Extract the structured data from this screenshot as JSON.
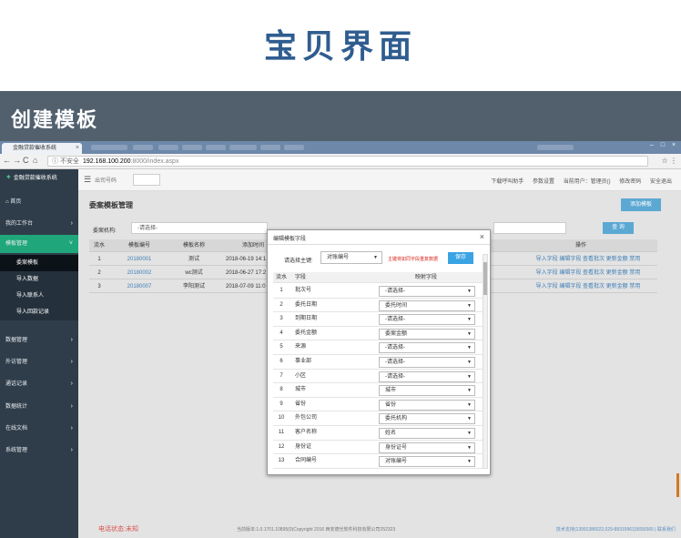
{
  "hero": {
    "title": "宝贝界面"
  },
  "banner": {
    "title": "创建模板"
  },
  "browser": {
    "tab_title": "金融贷款催收系统",
    "tab_close": "×",
    "nav": {
      "back": "←",
      "forward": "→",
      "reload": "C",
      "home": "⌂"
    },
    "url_unsafe": "ⓘ 不安全",
    "url_host": "192.168.100.200",
    "url_rest": ":8000/index.aspx",
    "star": "☆",
    "menu": "⋮",
    "win_min": "–",
    "win_max": "□",
    "win_close": "×"
  },
  "sidebar": {
    "logo": "金融贷款催收系统",
    "items": [
      {
        "label": "首页",
        "arrow": ""
      },
      {
        "label": "我的工作台",
        "arrow": "›"
      },
      {
        "label": "模板管理",
        "arrow": "˅"
      },
      {
        "label": "数据管理",
        "arrow": "›"
      },
      {
        "label": "外访管理",
        "arrow": "›"
      },
      {
        "label": "通话记录",
        "arrow": "›"
      },
      {
        "label": "数据统计",
        "arrow": "›"
      },
      {
        "label": "在线文档",
        "arrow": "›"
      },
      {
        "label": "系统管理",
        "arrow": "›"
      }
    ],
    "sub_items": [
      {
        "label": "委案模板"
      },
      {
        "label": "导入数据"
      },
      {
        "label": "导入联系人"
      },
      {
        "label": "导入回款记录"
      }
    ]
  },
  "topnav": {
    "menu_icon": "☰",
    "search_label": "出司号码",
    "links": [
      "下载呼叫助手",
      "参数设置",
      "当前用户：管理员()",
      "修改密码",
      "安全退出"
    ]
  },
  "content": {
    "panel_title": "委案模板管理",
    "add_button": "添加模板",
    "filter_label": "委案机构:",
    "filter_placeholder": "-请选择-",
    "query_button": "查 询",
    "table": {
      "headers": [
        "流水",
        "模板编号",
        "模板名称",
        "添加时间",
        "操作"
      ],
      "rows": [
        {
          "no": "1",
          "code": "20180001",
          "name": "测试",
          "time": "2018-06-19 14:1",
          "ops": "导入字段 编辑字段 查看批次 更新金额 禁用"
        },
        {
          "no": "2",
          "code": "20180002",
          "name": "wc测试",
          "time": "2018-06-27 17:2",
          "ops": "导入字段 编辑字段 查看批次 更新金额 禁用"
        },
        {
          "no": "3",
          "code": "20180007",
          "name": "李阳测试",
          "time": "2018-07-09 11:0",
          "ops": "导入字段 编辑字段 查看批次 更新金额 禁用"
        }
      ]
    },
    "footer_status": "电话状态:未知",
    "footer_copy": "当前版本:1.0.1701.10895(0)Copyright 2016 西安德光软件科技有限公司252323",
    "footer_right": "技术支持(13991386022,029-88319961)5656565 | 联系我们"
  },
  "modal": {
    "title": "编辑模板字段",
    "close": "×",
    "key_label": "请选择主键:",
    "key_value": "对账编号",
    "key_hint": "主键将如同字段重复数据",
    "save_button": "保存",
    "headers": [
      "流水",
      "字段",
      "映射字段"
    ],
    "rows": [
      {
        "no": "1",
        "field": "批次号",
        "map": "-请选择-"
      },
      {
        "no": "2",
        "field": "委托日期",
        "map": "委托时间"
      },
      {
        "no": "3",
        "field": "到期日期",
        "map": "-请选择-"
      },
      {
        "no": "4",
        "field": "委托金额",
        "map": "委案金额"
      },
      {
        "no": "5",
        "field": "来源",
        "map": "-请选择-"
      },
      {
        "no": "6",
        "field": "事业部",
        "map": "-请选择-"
      },
      {
        "no": "7",
        "field": "小区",
        "map": "-请选择-"
      },
      {
        "no": "8",
        "field": "城市",
        "map": "城市"
      },
      {
        "no": "9",
        "field": "省份",
        "map": "省份"
      },
      {
        "no": "10",
        "field": "外包公司",
        "map": "委托机构"
      },
      {
        "no": "11",
        "field": "客户名称",
        "map": "姓名"
      },
      {
        "no": "12",
        "field": "身份证",
        "map": "身份证号"
      },
      {
        "no": "13",
        "field": "合同编号",
        "map": "对账编号"
      }
    ]
  }
}
